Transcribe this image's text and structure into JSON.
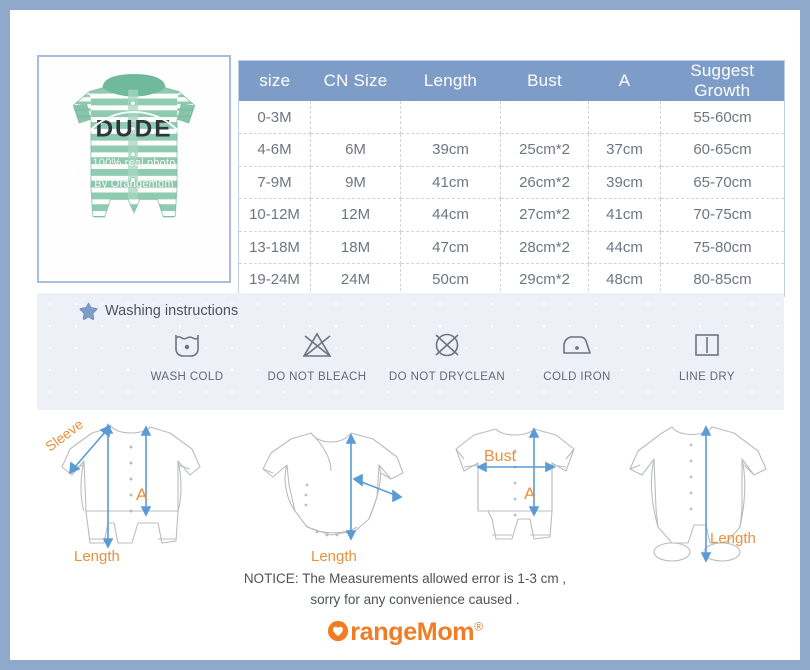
{
  "product_photo": {
    "alt": "green-striped-baby-romper",
    "garment_text": "DUDE",
    "watermark_line1": "100% real photo",
    "watermark_line2": "By Orangemom"
  },
  "size_table": {
    "headers": [
      "size",
      "CN Size",
      "Length",
      "Bust",
      "A",
      "Suggest Growth"
    ],
    "rows": [
      [
        "0-3M",
        "",
        "",
        "",
        "",
        "55-60cm"
      ],
      [
        "4-6M",
        "6M",
        "39cm",
        "25cm*2",
        "37cm",
        "60-65cm"
      ],
      [
        "7-9M",
        "9M",
        "41cm",
        "26cm*2",
        "39cm",
        "65-70cm"
      ],
      [
        "10-12M",
        "12M",
        "44cm",
        "27cm*2",
        "41cm",
        "70-75cm"
      ],
      [
        "13-18M",
        "18M",
        "47cm",
        "28cm*2",
        "44cm",
        "75-80cm"
      ],
      [
        "19-24M",
        "24M",
        "50cm",
        "29cm*2",
        "48cm",
        "80-85cm"
      ]
    ]
  },
  "washing": {
    "title": "Washing instructions",
    "title_icon": "star-icon",
    "items": [
      {
        "icon": "wash-cold-icon",
        "label": "WASH COLD"
      },
      {
        "icon": "do-not-bleach-icon",
        "label": "DO NOT BLEACH"
      },
      {
        "icon": "do-not-dryclean-icon",
        "label": "DO NOT DRYCLEAN"
      },
      {
        "icon": "cold-iron-icon",
        "label": "COLD IRON"
      },
      {
        "icon": "line-dry-icon",
        "label": "LINE DRY"
      }
    ]
  },
  "diagrams": [
    {
      "name": "long-sleeve-romper-sleeve-length-a",
      "labels": [
        "Sleeve",
        "A",
        "Length"
      ]
    },
    {
      "name": "long-sleeve-bodysuit-length",
      "labels": [
        "Length"
      ]
    },
    {
      "name": "short-sleeve-romper-bust-a",
      "labels": [
        "Bust",
        "A"
      ]
    },
    {
      "name": "footed-sleepsuit-length",
      "labels": [
        "Length"
      ]
    }
  ],
  "notice": {
    "line1": "NOTICE:   The Measurements allowed error is 1-3 cm ,",
    "line2": "sorry for any convenience caused ."
  },
  "logo": {
    "text": "rangeMom",
    "registered": "®"
  },
  "colors": {
    "outer_border": "#8fa9cc",
    "table_header": "#7d9dc8",
    "wash_bg": "#edf0f6",
    "brand_orange": "#f07c24",
    "measure_blue": "#5b9bd5",
    "label_orange": "#e8913f"
  }
}
